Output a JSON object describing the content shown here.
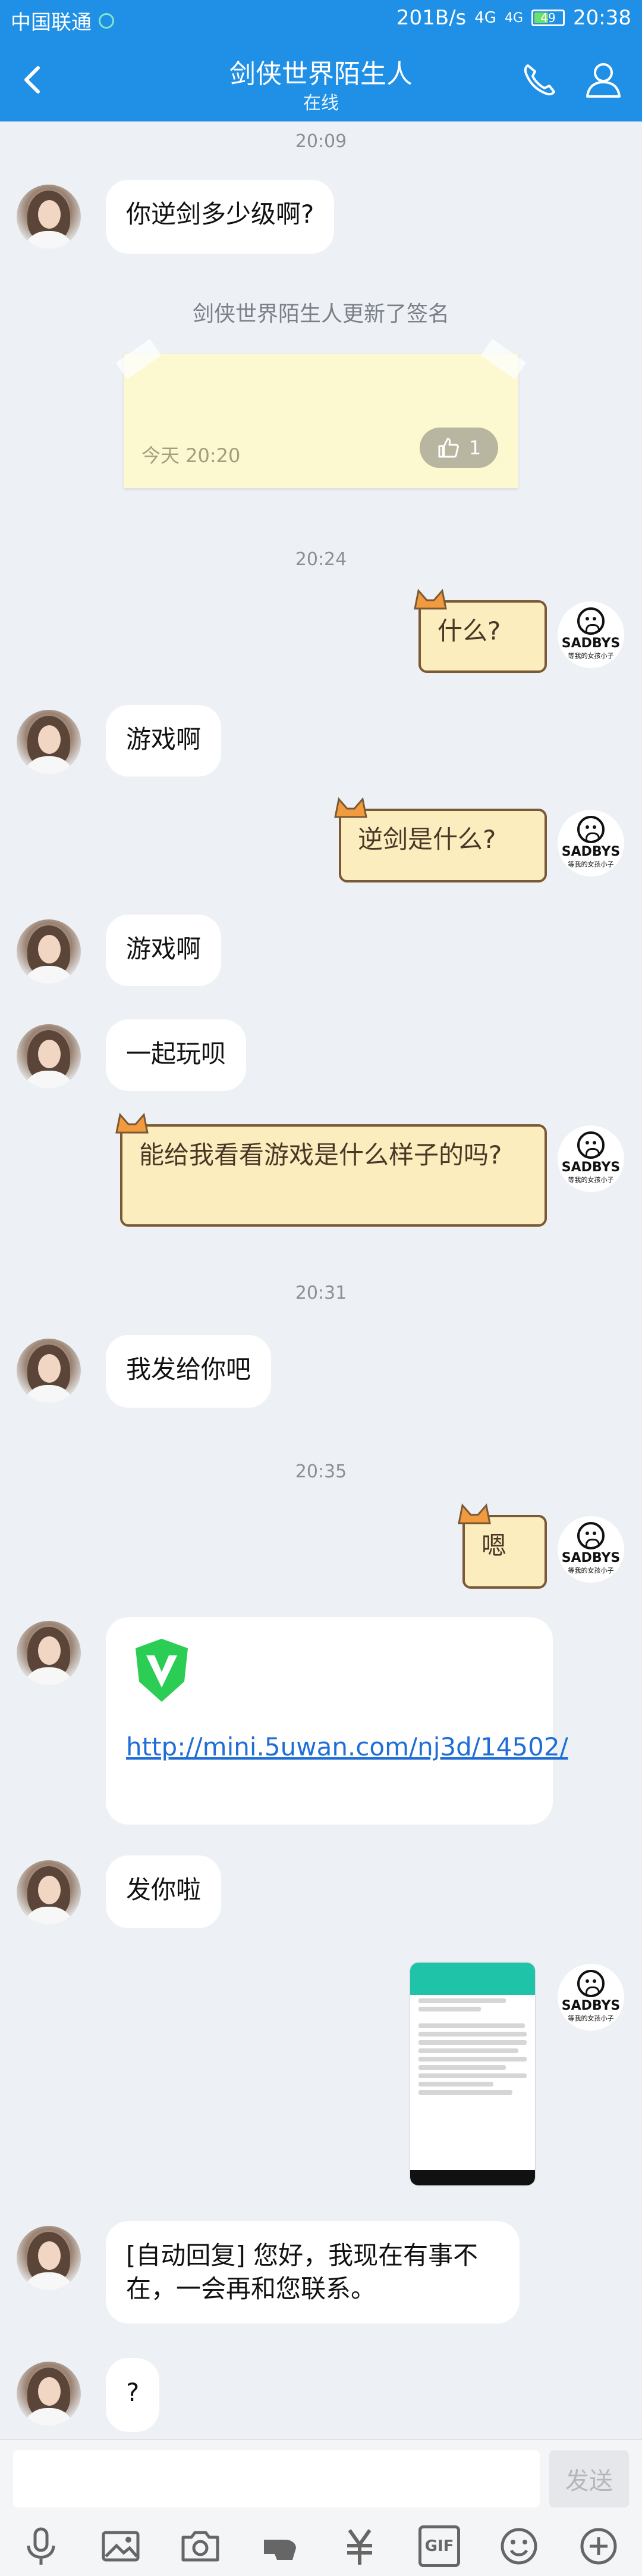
{
  "statusbar": {
    "carrier": "中国联通",
    "speed": "201B/s",
    "network": "4G",
    "network2": "4G",
    "battery": "49",
    "clock": "20:38"
  },
  "header": {
    "title": "剑侠世界陌生人",
    "subtitle": "在线"
  },
  "colors": {
    "header": "#1f90e6",
    "background": "#edf0f5",
    "user_bubble": "#fbedbe",
    "link": "#1e6ed6"
  },
  "messages": {
    "t1": "20:09",
    "m1": "你逆剑多少级啊?",
    "sys": "剑侠世界陌生人更新了签名",
    "note_date": "今天 20:20",
    "note_likes": "1",
    "t2": "20:24",
    "m2": "什么?",
    "m3": "游戏啊",
    "m4": "逆剑是什么?",
    "m5": "游戏啊",
    "m6": "一起玩呗",
    "m7": "能给我看看游戏是什么样子的吗?",
    "t3": "20:31",
    "m8": "我发给你吧",
    "t4": "20:35",
    "m9": "嗯",
    "m10_link": "http://mini.5uwan.com/nj3d/14502/",
    "m11": "发你啦",
    "m12": "[自动回复] 您好，我现在有事不在，一会再和您联系。",
    "m13": "?"
  },
  "avatar_right": {
    "brand": "SADBYS",
    "tag": "等我的女孩小子"
  },
  "input": {
    "send_label": "发送",
    "placeholder": ""
  },
  "toolbar": {
    "gif_label": "GIF",
    "icons": [
      "mic-icon",
      "image-icon",
      "camera-icon",
      "hongbao-icon",
      "yuan-icon",
      "gif-icon",
      "emoji-icon",
      "plus-icon"
    ]
  }
}
